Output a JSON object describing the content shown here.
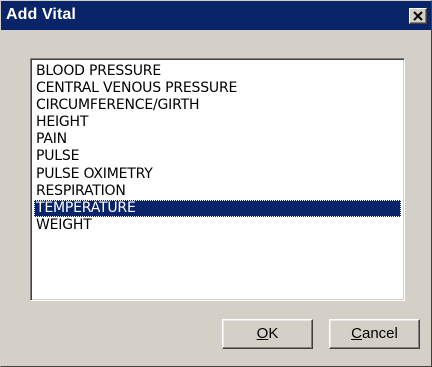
{
  "window": {
    "title": "Add Vital"
  },
  "vitals": {
    "items": [
      "BLOOD PRESSURE",
      "CENTRAL VENOUS PRESSURE",
      "CIRCUMFERENCE/GIRTH",
      "HEIGHT",
      "PAIN",
      "PULSE",
      "PULSE OXIMETRY",
      "RESPIRATION",
      "TEMPERATURE",
      "WEIGHT"
    ],
    "selected": "TEMPERATURE"
  },
  "buttons": {
    "ok_label": "OK",
    "ok_accel": "O",
    "ok_rest": "K",
    "cancel_label": "Cancel",
    "cancel_accel": "C",
    "cancel_rest": "ancel"
  },
  "colors": {
    "titlebar": "#0a246a",
    "selection": "#0a246a",
    "face": "#d4d0c8"
  },
  "icons": {
    "close": "close-icon"
  }
}
